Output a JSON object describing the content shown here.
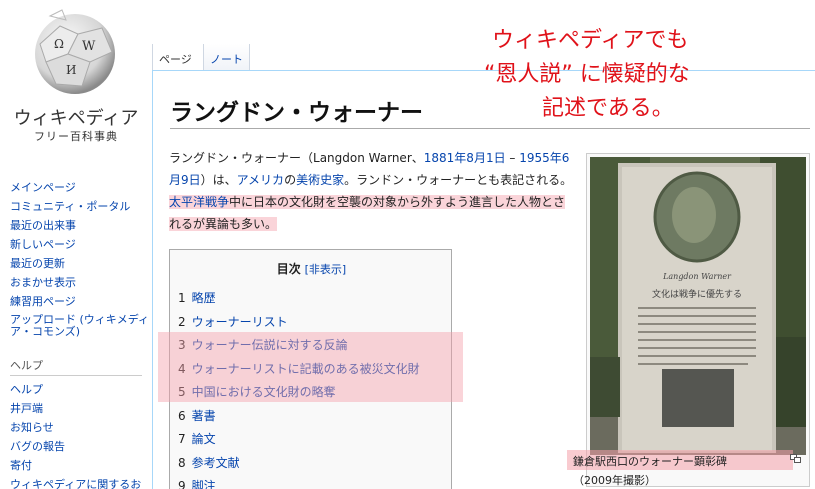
{
  "sidebar": {
    "site_name": "ウィキペディア",
    "site_subtitle": "フリー百科事典",
    "nav": [
      "メインページ",
      "コミュニティ・ポータル",
      "最近の出来事",
      "新しいページ",
      "最近の更新",
      "おまかせ表示",
      "練習用ページ",
      "アップロード (ウィキメディア・コモンズ)"
    ],
    "help_heading": "ヘルプ",
    "help_items": [
      "ヘルプ",
      "井戸端",
      "お知らせ",
      "バグの報告",
      "寄付",
      "ウィキペディアに関するお"
    ]
  },
  "tabs": {
    "page": "ページ",
    "talk": "ノート"
  },
  "article": {
    "title": "ラングドン・ウォーナー",
    "lead": {
      "name": "ラングドン・ウォーナー",
      "paren_open": "（Langdon Warner、",
      "born": "1881年8月1日",
      "dash": " – ",
      "died": "1955年6月9日",
      "after_dates": "）は、",
      "country": "アメリカ",
      "no": "の",
      "profession": "美術史家",
      "rest1": "。ランドン・ウォーナーとも表記される。",
      "war": "太平洋戦争",
      "rest2": "中に日本の文化財を空襲の対象から外すよう進言した人物とされるが異論も多い。"
    },
    "toc": {
      "title": "目次",
      "toggle": "[非表示]",
      "items": [
        {
          "num": "1",
          "text": "略歴"
        },
        {
          "num": "2",
          "text": "ウォーナーリスト"
        },
        {
          "num": "3",
          "text": "ウォーナー伝説に対する反論"
        },
        {
          "num": "4",
          "text": "ウォーナーリストに記載のある被災文化財"
        },
        {
          "num": "5",
          "text": "中国における文化財の略奪"
        },
        {
          "num": "6",
          "text": "著書"
        },
        {
          "num": "7",
          "text": "論文"
        },
        {
          "num": "8",
          "text": "参考文献"
        },
        {
          "num": "9",
          "text": "脚注"
        }
      ]
    },
    "image": {
      "caption": "鎌倉駅西口のウォーナー顕彰碑",
      "caption_sub": "（2009年撮影）",
      "plaque_heading": "Langdon Warner",
      "plaque_text": "文化は戦争に優先する"
    }
  },
  "annotation": {
    "lines": [
      "ウィキペディアでも",
      "“恩人説” に懐疑的な",
      "記述である。"
    ],
    "color": "#e0121a"
  },
  "colors": {
    "link": "#0645ad",
    "highlight": "#f4a0aa",
    "border": "#a7d7f9"
  }
}
